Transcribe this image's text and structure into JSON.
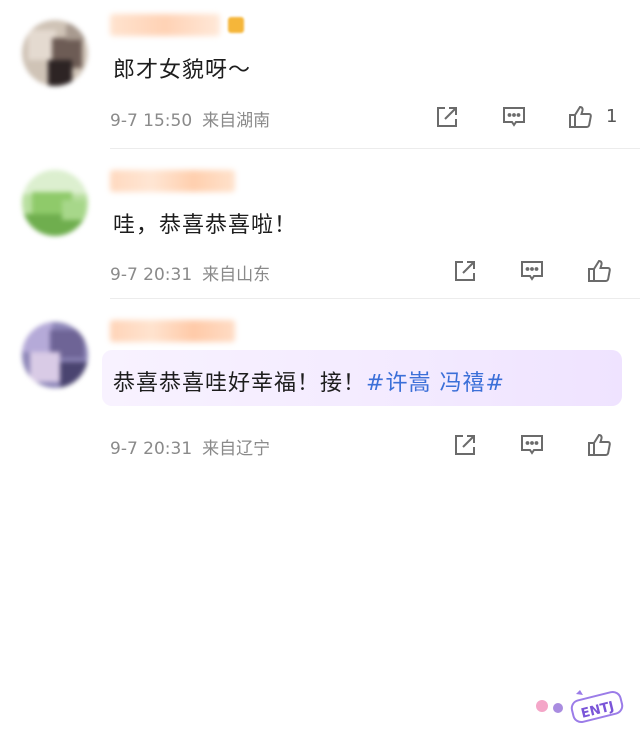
{
  "comments": [
    {
      "text": "郎才女貌呀～",
      "time": "9-7 15:50",
      "location": "来自湖南",
      "likes": "1"
    },
    {
      "text": "哇，恭喜恭喜啦！",
      "time": "9-7 20:31",
      "location": "来自山东",
      "likes": ""
    },
    {
      "text": "恭喜恭喜哇好幸福！接！",
      "hashtag": "#许嵩 冯禧#",
      "time": "9-7 20:31",
      "location": "来自辽宁",
      "likes": ""
    }
  ],
  "icons": {
    "share": "share-icon",
    "comment": "comment-icon",
    "like": "thumbs-up-icon"
  },
  "colors": {
    "hashtag": "#3b6fd8",
    "username": "#ff7a00",
    "meta": "#8a8a8a",
    "highlight": "#f3eaff"
  }
}
